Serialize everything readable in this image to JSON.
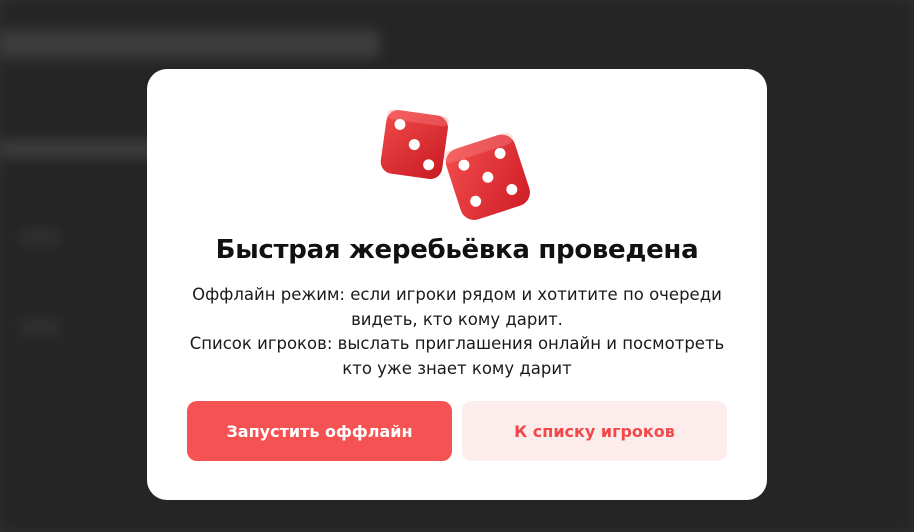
{
  "modal": {
    "title": "Быстрая жеребьёвка проведена",
    "description_line1": "Оффлайн режим: если игроки рядом и хотитите по очереди видеть, кто кому дарит.",
    "description_line2": "Список игроков: выслать приглашения онлайн и посмотреть кто уже знает кому дарит",
    "primary_button_label": "Запустить оффлайн",
    "secondary_button_label": "К списку игроков",
    "illustration": "dice-icon"
  },
  "colors": {
    "primary": "#f55253",
    "secondary_bg": "#fdecec",
    "secondary_text": "#f2484a",
    "dice": "#e8282d",
    "overlay_bg": "#2e2e2e"
  }
}
